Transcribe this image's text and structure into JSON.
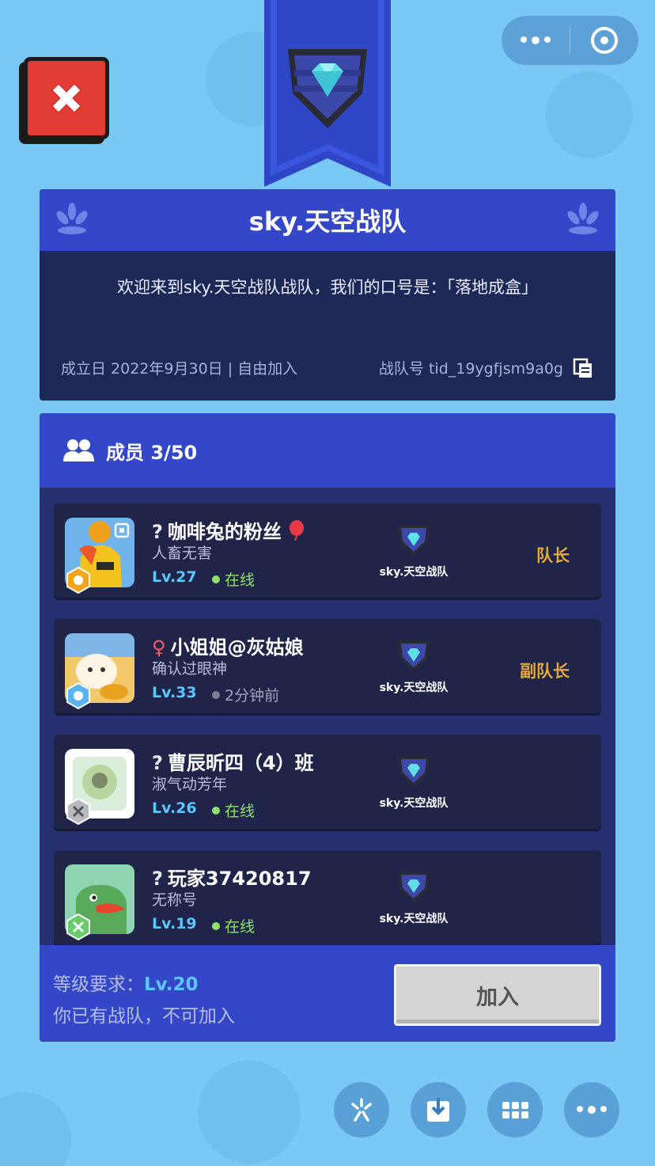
{
  "capsule": {
    "more_icon": "more-dots-icon",
    "close_icon": "target-ring-icon"
  },
  "close_icon": "x-icon",
  "team": {
    "name": "sky.天空战队",
    "slogan": "欢迎来到sky.天空战队战队，我们的口号是：「落地成盒」",
    "founded": "成立日 2022年9月30日 | 自由加入",
    "team_id": "战队号 tid_19ygfjsm9a0g"
  },
  "members_section": {
    "count_label": "成员 3/50",
    "rows": [
      {
        "gender": "?",
        "name": "咖啡兔的粉丝",
        "title": "人畜无害",
        "level": "Lv.27",
        "status": "在线",
        "online": true,
        "team": "sky.天空战队",
        "role": "队长"
      },
      {
        "gender": "♀",
        "name": "小姐姐@灰姑娘",
        "title": "确认过眼神",
        "level": "Lv.33",
        "status": "2分钟前",
        "online": false,
        "team": "sky.天空战队",
        "role": "副队长"
      },
      {
        "gender": "?",
        "name": "曹辰昕四（4）班",
        "title": "淑气动芳年",
        "level": "Lv.26",
        "status": "在线",
        "online": true,
        "team": "sky.天空战队",
        "role": ""
      },
      {
        "gender": "?",
        "name": "玩家37420817",
        "title": "无称号",
        "level": "Lv.19",
        "status": "在线",
        "online": true,
        "team": "sky.天空战队",
        "role": ""
      }
    ]
  },
  "join": {
    "requirement_label": "等级要求：",
    "requirement_level": "Lv.20",
    "cannot_join": "你已有战队，不可加入",
    "button_label": "加入"
  },
  "colors": {
    "background": "#79c8f5",
    "header_blue": "#3347c8",
    "card_dark": "#1e2856",
    "online": "#8ee26a",
    "role": "#e3a93a",
    "level": "#5cc6ff"
  }
}
